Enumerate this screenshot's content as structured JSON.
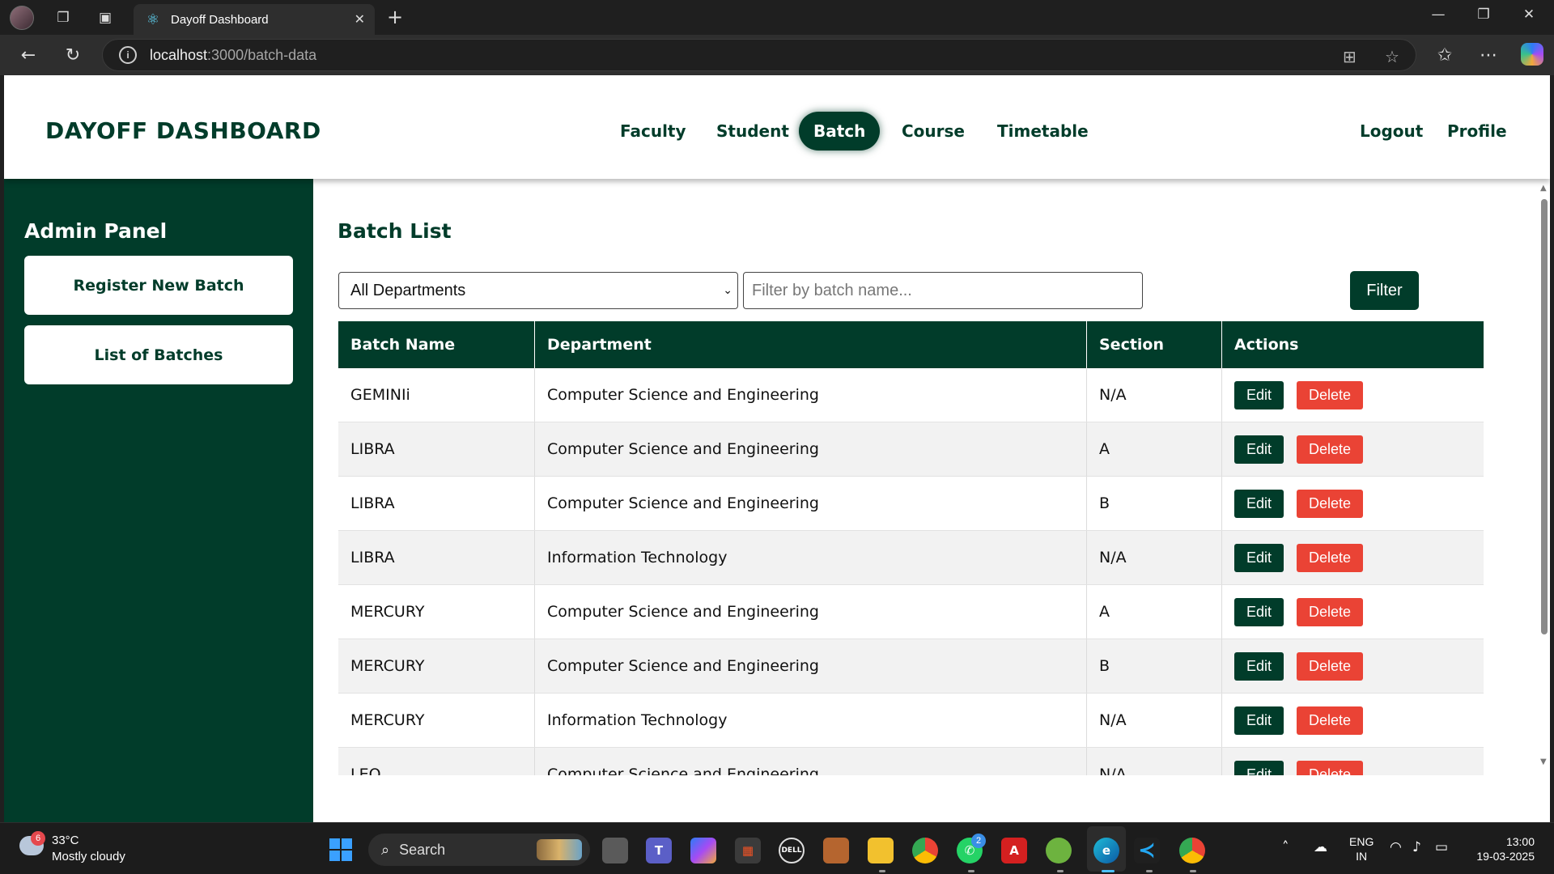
{
  "browser": {
    "tab_title": "Dayoff Dashboard",
    "url_host": "localhost",
    "url_path": ":3000/batch-data"
  },
  "header": {
    "brand": "DAYOFF DASHBOARD",
    "nav": [
      "Faculty",
      "Student",
      "Batch",
      "Course",
      "Timetable"
    ],
    "active_nav": "Batch",
    "logout": "Logout",
    "profile": "Profile"
  },
  "sidebar": {
    "title": "Admin Panel",
    "buttons": [
      "Register New Batch",
      "List of Batches"
    ]
  },
  "main": {
    "title": "Batch List",
    "department_select": "All Departments",
    "name_filter_placeholder": "Filter by batch name...",
    "filter_button": "Filter",
    "columns": [
      "Batch Name",
      "Department",
      "Section",
      "Actions"
    ],
    "edit_label": "Edit",
    "delete_label": "Delete",
    "rows": [
      {
        "batch": "GEMINIi",
        "department": "Computer Science and Engineering",
        "section": "N/A"
      },
      {
        "batch": "LIBRA",
        "department": "Computer Science and Engineering",
        "section": "A"
      },
      {
        "batch": "LIBRA",
        "department": "Computer Science and Engineering",
        "section": "B"
      },
      {
        "batch": "LIBRA",
        "department": "Information Technology",
        "section": "N/A"
      },
      {
        "batch": "MERCURY",
        "department": "Computer Science and Engineering",
        "section": "A"
      },
      {
        "batch": "MERCURY",
        "department": "Computer Science and Engineering",
        "section": "B"
      },
      {
        "batch": "MERCURY",
        "department": "Information Technology",
        "section": "N/A"
      },
      {
        "batch": "LEO",
        "department": "Computer Science and Engineering",
        "section": "N/A"
      }
    ]
  },
  "taskbar": {
    "weather_temp": "33°C",
    "weather_desc": "Mostly cloudy",
    "weather_badge": "6",
    "search_label": "Search",
    "whatsapp_badge": "2",
    "lang_line1": "ENG",
    "lang_line2": "IN",
    "time": "13:00",
    "date": "19-03-2025"
  },
  "colors": {
    "brand_green": "#013c2a",
    "delete_red": "#ea4335"
  }
}
